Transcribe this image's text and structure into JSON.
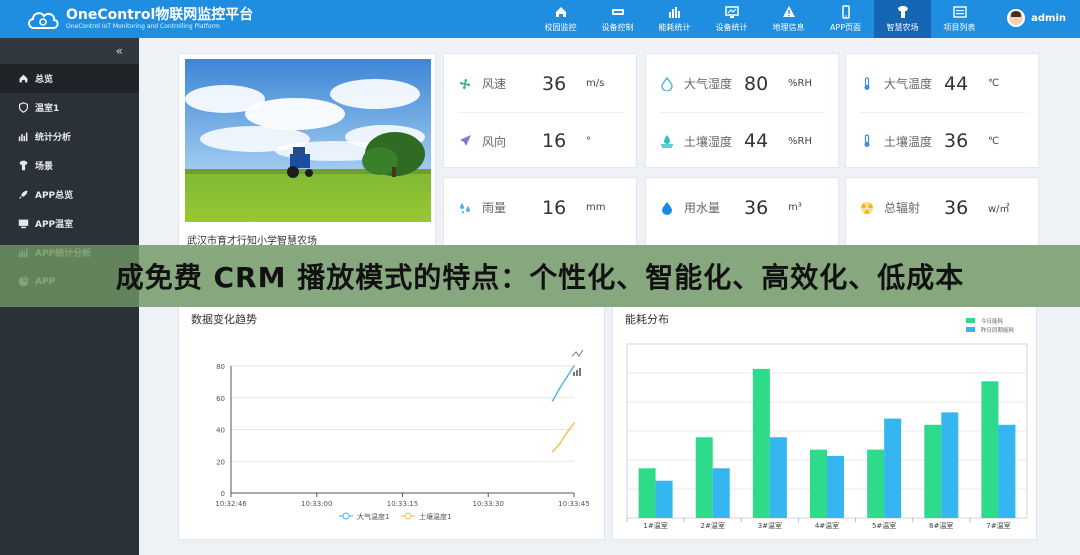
{
  "header": {
    "title": "OneControl物联网监控平台",
    "subtitle": "OneControl IoT Monitoring and Controlling Platform",
    "user": "admin",
    "nav": [
      {
        "label": "校园监控",
        "icon": "home-icon"
      },
      {
        "label": "设备控制",
        "icon": "device-icon"
      },
      {
        "label": "能耗统计",
        "icon": "bar-stats-icon"
      },
      {
        "label": "设备统计",
        "icon": "monitor-icon"
      },
      {
        "label": "地理信息",
        "icon": "warning-icon"
      },
      {
        "label": "APP页面",
        "icon": "phone-icon"
      },
      {
        "label": "智慧农场",
        "icon": "tshirt-icon"
      },
      {
        "label": "项目列表",
        "icon": "list-icon"
      }
    ],
    "active_nav": 6
  },
  "sidebar": {
    "collapse": "«",
    "items": [
      {
        "label": "总览",
        "icon": "home-icon"
      },
      {
        "label": "温室1",
        "icon": "shield-icon"
      },
      {
        "label": "统计分析",
        "icon": "bar-chart-icon"
      },
      {
        "label": "场景",
        "icon": "tshirt-icon"
      },
      {
        "label": "APP总览",
        "icon": "rocket-icon"
      },
      {
        "label": "APP温室",
        "icon": "computer-icon"
      },
      {
        "label": "APP统计分析",
        "icon": "bar-chart-icon"
      },
      {
        "label": "APP",
        "icon": "pie-chart-icon"
      }
    ]
  },
  "farm": {
    "caption": "武汉市育才行知小学智慧农场"
  },
  "metrics": [
    {
      "label": "风速",
      "value": "36",
      "unit": "m/s",
      "icon": "fan-icon",
      "color": "#2ab27b"
    },
    {
      "label": "风向",
      "value": "16",
      "unit": "°",
      "icon": "direction-icon",
      "color": "#8b6fd6"
    },
    {
      "label": "大气湿度",
      "value": "80",
      "unit": "%RH",
      "icon": "droplet-icon",
      "color": "#4fb3e8"
    },
    {
      "label": "土壤湿度",
      "value": "44",
      "unit": "%RH",
      "icon": "soil-icon",
      "color": "#2cc1c7"
    },
    {
      "label": "大气温度",
      "value": "44",
      "unit": "℃",
      "icon": "thermometer-icon",
      "color": "#3b8de0"
    },
    {
      "label": "土壤温度",
      "value": "36",
      "unit": "℃",
      "icon": "thermometer-icon",
      "color": "#3b8de0"
    },
    {
      "label": "雨量",
      "value": "16",
      "unit": "mm",
      "icon": "rain-icon",
      "color": "#4fb3e8"
    },
    {
      "label": "用水量",
      "value": "36",
      "unit": "m³",
      "icon": "water-drop-icon",
      "color": "#1e88e5"
    },
    {
      "label": "总辐射",
      "value": "36",
      "unit": "w/㎡",
      "icon": "radiation-icon",
      "color": "#f5b820"
    }
  ],
  "chart_data": [
    {
      "type": "line",
      "title": "数据变化趋势",
      "x": [
        "10:32:46",
        "10:33:00",
        "10:33:15",
        "10:33:30",
        "10:33:45"
      ],
      "ylim": [
        0,
        80
      ],
      "yticks": [
        0,
        20,
        40,
        60,
        80
      ],
      "series": [
        {
          "name": "大气温度1",
          "color": "#4fb3e8",
          "values": [
            [
              45,
              58
            ],
            [
              46,
              66
            ],
            [
              47,
              73
            ],
            [
              48,
              80
            ]
          ]
        },
        {
          "name": "土壤温度1",
          "color": "#f2c14e",
          "values": [
            [
              45,
              26
            ],
            [
              46,
              31
            ],
            [
              47,
              38
            ],
            [
              48,
              44
            ]
          ]
        }
      ]
    },
    {
      "type": "bar",
      "title": "能耗分布",
      "categories": [
        "1#温室",
        "2#温室",
        "3#温室",
        "4#温室",
        "5#温室",
        "6#温室",
        "7#温室"
      ],
      "series": [
        {
          "name": "今日能耗",
          "color": "#2edb8a",
          "values": [
            8,
            13,
            24,
            11,
            11,
            15,
            22
          ]
        },
        {
          "name": "昨日同期能耗",
          "color": "#35b6f0",
          "values": [
            6,
            8,
            13,
            10,
            16,
            17,
            15
          ]
        }
      ],
      "ylim": [
        0,
        28
      ]
    }
  ],
  "banner": {
    "text": "成免费 CRM 播放模式的特点：个性化、智能化、高效化、低成本"
  }
}
